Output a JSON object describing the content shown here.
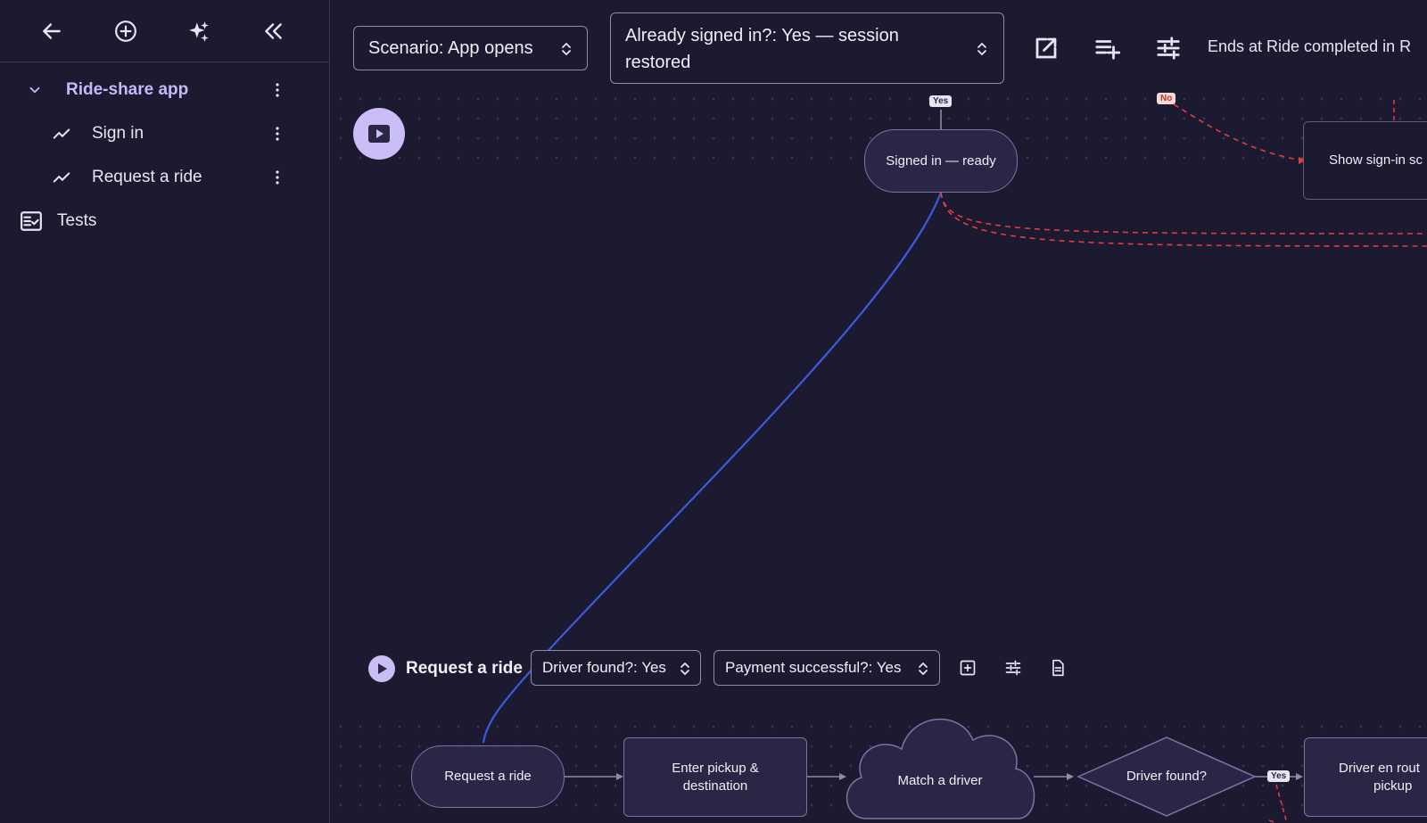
{
  "sidebar": {
    "tree": {
      "root_label": "Ride-share app",
      "children": [
        {
          "label": "Sign in"
        },
        {
          "label": "Request a ride"
        }
      ],
      "tests_label": "Tests"
    }
  },
  "toolbar": {
    "scenario_select": "Scenario: App opens",
    "signed_in_select_line1": "Already signed in?: Yes — session",
    "signed_in_select_line2": "restored",
    "ends_text": "Ends at Ride completed in R"
  },
  "flow_top": {
    "node_signed_in": "Signed in — ready",
    "node_show_signin": "Show sign-in sc",
    "tag_yes": "Yes",
    "tag_no": "No"
  },
  "lane": {
    "title": "Request a ride",
    "driver_select": "Driver found?: Yes",
    "payment_select": "Payment successful?: Yes",
    "nodes": {
      "request": "Request a ride",
      "enter_line1": "Enter pickup &",
      "enter_line2": "destination",
      "match": "Match a driver",
      "decision": "Driver found?",
      "enroute_line1": "Driver en rout",
      "enroute_line2": "pickup"
    },
    "tag_yes": "Yes"
  },
  "colors": {
    "background": "#1c1a31",
    "accent": "#cbbdf6",
    "node_fill": "#2a2746",
    "edge_blue": "#3b5bdb",
    "edge_red": "#e03e3e"
  }
}
